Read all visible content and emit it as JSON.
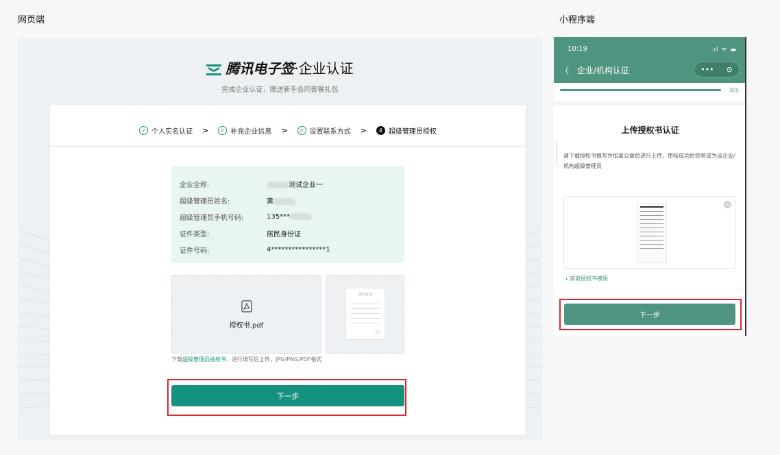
{
  "labels": {
    "web": "网页端",
    "mini": "小程序端"
  },
  "web": {
    "brand": {
      "name": "腾讯电子签",
      "suffix": "·企业认证"
    },
    "tagline": "完成企业认证，赠送新手合同套餐礼包",
    "steps": [
      {
        "label": "个人实名认证",
        "state": "done"
      },
      {
        "label": "补充企业信息",
        "state": "done"
      },
      {
        "label": "设置联系方式",
        "state": "done"
      },
      {
        "label": "超级管理员授权",
        "state": "active",
        "num": "4"
      }
    ],
    "info": {
      "rows": [
        {
          "key": "企业全称:",
          "value": "测试企业一"
        },
        {
          "key": "超级管理员姓名:",
          "value": "黄"
        },
        {
          "key": "超级管理员手机号码:",
          "value": "135***"
        },
        {
          "key": "证件类型:",
          "value": "居民身份证"
        },
        {
          "key": "证件号码:",
          "value": "4****************1"
        }
      ]
    },
    "upload": {
      "filename": "授权书.pdf",
      "preview_title": "授权证书"
    },
    "hint": {
      "prefix": "下载",
      "link": "超级管理员授权书",
      "suffix": "、进行填写后上传，JPG/PNG/PDF格式"
    },
    "next": "下一步"
  },
  "mini": {
    "status": {
      "time": "10:19",
      "icons": "..ıl ᯤ ▬"
    },
    "nav": {
      "back": "〈",
      "title": "企业/机构认证"
    },
    "capsule": {
      "more": "•••",
      "close": "⊙"
    },
    "progress": {
      "text": "3/3",
      "value": 1.0
    },
    "title": "上传授权书认证",
    "desc": "请下载授权书填写并加盖公章后进行上传，审核成功后您将成为该企业/机构超级管理员",
    "template_link": "获取授权书模版",
    "next": "下一步",
    "colors": {
      "primary": "#4f9480",
      "accent": "#15917f",
      "highlight": "#e0262b"
    }
  }
}
